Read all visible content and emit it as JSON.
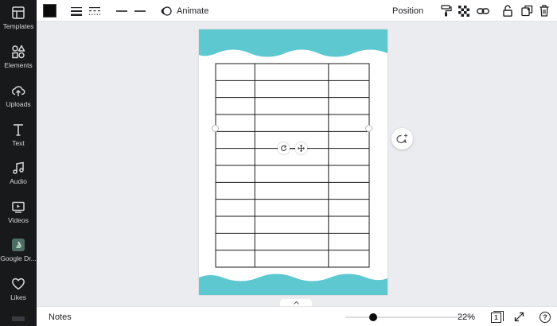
{
  "sidebar": {
    "items": [
      {
        "label": "Templates"
      },
      {
        "label": "Elements"
      },
      {
        "label": "Uploads"
      },
      {
        "label": "Text"
      },
      {
        "label": "Audio"
      },
      {
        "label": "Videos"
      },
      {
        "label": "Google Dr..."
      },
      {
        "label": "Likes"
      }
    ]
  },
  "toolbar": {
    "color": "#0b0b0b",
    "animate_label": "Animate",
    "position_label": "Position"
  },
  "canvas": {
    "accent_color": "#5ec8d0",
    "table": {
      "rows": 12,
      "columns": 3,
      "line_color": "#1a1a1a"
    }
  },
  "bottombar": {
    "notes_label": "Notes",
    "zoom_percent": 22,
    "zoom_label": "22%",
    "page_count": "1",
    "help_label": "?"
  }
}
